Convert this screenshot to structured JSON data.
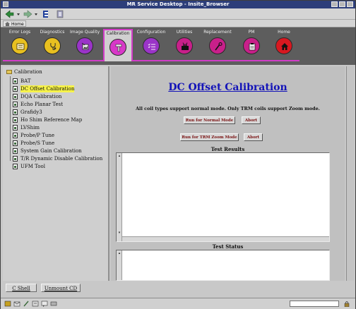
{
  "window": {
    "title": "MR Service Desktop - Insite_Browser"
  },
  "toolbar": {
    "home_label": "Home"
  },
  "tabs": [
    {
      "label": "Error Logs",
      "icon": "error-logs-icon",
      "color": "#e8c020"
    },
    {
      "label": "Diagnostics",
      "icon": "stethoscope-icon",
      "color": "#e8c020"
    },
    {
      "label": "Image Quality",
      "icon": "image-quality-icon",
      "color": "#9a34c8"
    },
    {
      "label": "Calibration",
      "icon": "hammer-icon",
      "color": "#d838c8",
      "active": true
    },
    {
      "label": "Configuration",
      "icon": "checklist-icon",
      "color": "#9a34c8"
    },
    {
      "label": "Utilities",
      "icon": "toolbox-icon",
      "color": "#c8208a"
    },
    {
      "label": "Replacement",
      "icon": "wrench-icon",
      "color": "#c8208a"
    },
    {
      "label": "PM",
      "icon": "clipboard-icon",
      "color": "#c8208a"
    },
    {
      "label": "Home",
      "icon": "house-icon",
      "color": "#d81820"
    }
  ],
  "tree": {
    "root": "Calibration",
    "items": [
      "BAT",
      "DC Offset Calibration",
      "DQA Calibration",
      "Echo Planar Test",
      "Grafidy3",
      "Ho Shim Reference Map",
      "LVShim",
      "Probe/P Tune",
      "Probe/S Tune",
      "System Gain Calibration",
      "T/R Dynamic Disable Calibration",
      "UFM Tool"
    ],
    "selected": "DC Offset Calibration"
  },
  "bottom_buttons": {
    "cshell": "C Shell",
    "unmount": "Unmount CD"
  },
  "main": {
    "title": "DC Offset Calibration",
    "note": "All coil types support normal mode. Only TRM coils support Zoom mode.",
    "run_normal": "Run for Normal Mode",
    "abort_1": "Abort",
    "run_trm": "Run for TRM Zoom Mode",
    "abort_2": "Abort",
    "results_title": "Test Results",
    "status_title": "Test Status"
  }
}
